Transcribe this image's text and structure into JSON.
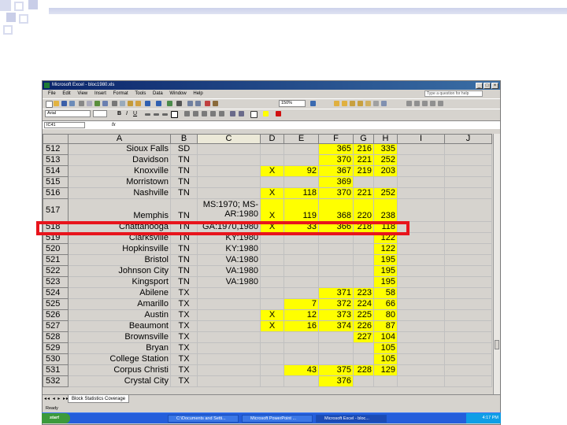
{
  "window": {
    "title": "Microsoft Excel - bloc1980.xls",
    "menu": [
      "File",
      "Edit",
      "View",
      "Insert",
      "Format",
      "Tools",
      "Data",
      "Window",
      "Help"
    ],
    "help_placeholder": "Type a question for help",
    "zoom": "150%",
    "font_name": "Arial",
    "name_box": "IC41",
    "fx": "fx"
  },
  "columns": [
    "A",
    "B",
    "C",
    "D",
    "E",
    "F",
    "G",
    "H",
    "I",
    "J"
  ],
  "rows": [
    {
      "n": "512",
      "A": "Sioux Falls",
      "B": "SD",
      "C": "",
      "D": "",
      "E": "",
      "F": "365",
      "G": "216",
      "H": "335"
    },
    {
      "n": "513",
      "A": "Davidson",
      "B": "TN",
      "C": "",
      "D": "",
      "E": "",
      "F": "370",
      "G": "221",
      "H": "252"
    },
    {
      "n": "514",
      "A": "Knoxville",
      "B": "TN",
      "C": "",
      "D": "X",
      "E": "92",
      "F": "367",
      "G": "219",
      "H": "203"
    },
    {
      "n": "515",
      "A": "Morristown",
      "B": "TN",
      "C": "",
      "D": "",
      "E": "",
      "F": "369",
      "G": "",
      "H": ""
    },
    {
      "n": "516",
      "A": "Nashville",
      "B": "TN",
      "C": "",
      "D": "X",
      "E": "118",
      "F": "370",
      "G": "221",
      "H": "252"
    },
    {
      "n": "517",
      "A": "Memphis",
      "B": "TN",
      "C": "MS:1970; MS-AR:1980",
      "D": "X",
      "E": "119",
      "F": "368",
      "G": "220",
      "H": "238"
    },
    {
      "n": "518",
      "A": "Chattanooga",
      "B": "TN",
      "C": "GA:1970,1980",
      "D": "X",
      "E": "33",
      "F": "366",
      "G": "218",
      "H": "118"
    },
    {
      "n": "519",
      "A": "Clarksville",
      "B": "TN",
      "C": "KY:1980",
      "D": "",
      "E": "",
      "F": "",
      "G": "",
      "H": "122"
    },
    {
      "n": "520",
      "A": "Hopkinsville",
      "B": "TN",
      "C": "KY:1980",
      "D": "",
      "E": "",
      "F": "",
      "G": "",
      "H": "122"
    },
    {
      "n": "521",
      "A": "Bristol",
      "B": "TN",
      "C": "VA:1980",
      "D": "",
      "E": "",
      "F": "",
      "G": "",
      "H": "195"
    },
    {
      "n": "522",
      "A": "Johnson City",
      "B": "TN",
      "C": "VA:1980",
      "D": "",
      "E": "",
      "F": "",
      "G": "",
      "H": "195"
    },
    {
      "n": "523",
      "A": "Kingsport",
      "B": "TN",
      "C": "VA:1980",
      "D": "",
      "E": "",
      "F": "",
      "G": "",
      "H": "195"
    },
    {
      "n": "524",
      "A": "Abilene",
      "B": "TX",
      "C": "",
      "D": "",
      "E": "",
      "F": "371",
      "G": "223",
      "H": "58"
    },
    {
      "n": "525",
      "A": "Amarillo",
      "B": "TX",
      "C": "",
      "D": "",
      "E": "7",
      "F": "372",
      "G": "224",
      "H": "66"
    },
    {
      "n": "526",
      "A": "Austin",
      "B": "TX",
      "C": "",
      "D": "X",
      "E": "12",
      "F": "373",
      "G": "225",
      "H": "80"
    },
    {
      "n": "527",
      "A": "Beaumont",
      "B": "TX",
      "C": "",
      "D": "X",
      "E": "16",
      "F": "374",
      "G": "226",
      "H": "87"
    },
    {
      "n": "528",
      "A": "Brownsville",
      "B": "TX",
      "C": "",
      "D": "",
      "E": "",
      "F": "",
      "G": "227",
      "H": "104"
    },
    {
      "n": "529",
      "A": "Bryan",
      "B": "TX",
      "C": "",
      "D": "",
      "E": "",
      "F": "",
      "G": "",
      "H": "105"
    },
    {
      "n": "530",
      "A": "College Station",
      "B": "TX",
      "C": "",
      "D": "",
      "E": "",
      "F": "",
      "G": "",
      "H": "105"
    },
    {
      "n": "531",
      "A": "Corpus Christi",
      "B": "TX",
      "C": "",
      "D": "",
      "E": "43",
      "F": "375",
      "G": "228",
      "H": "129"
    },
    {
      "n": "532",
      "A": "Crystal City",
      "B": "TX",
      "C": "",
      "D": "",
      "E": "",
      "F": "376",
      "G": "",
      "H": ""
    }
  ],
  "highlight_color": "#e8141c",
  "cell_highlight_color": "#ffff00",
  "sheet_tab": "Block Statistics Coverage",
  "status": "Ready",
  "taskbar": {
    "start": "start",
    "tasks": [
      "C:\\Documents and Setti...",
      "Microsoft PowerPoint ...",
      "Microsoft Excel - bloc..."
    ],
    "active_task": "Microsoft Excel - bloc...",
    "clock": "4:17 PM"
  }
}
